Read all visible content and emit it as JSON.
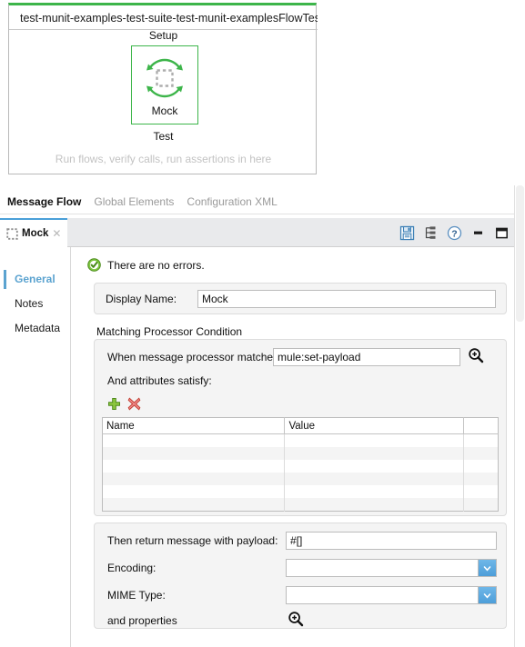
{
  "canvas": {
    "flow_title": "test-munit-examples-test-suite-test-munit-examplesFlowTest",
    "setup_label": "Setup",
    "node_label": "Mock",
    "node_icon": "mock-dashed-square-icon",
    "test_label": "Test",
    "hint_text": "Run flows, verify calls, run assertions in here",
    "accent_color": "#3db54a"
  },
  "view_tabs": [
    {
      "label": "Message Flow",
      "active": true
    },
    {
      "label": "Global Elements",
      "active": false
    },
    {
      "label": "Configuration XML",
      "active": false
    }
  ],
  "editor": {
    "tab_label": "Mock",
    "tab_icon": "mock-dashed-square-icon",
    "tab_close_glyph": "✕",
    "toolbar": [
      {
        "name": "save-icon",
        "title": "Save"
      },
      {
        "name": "outline-tree-icon",
        "title": "Outline"
      },
      {
        "name": "help-icon",
        "title": "Help"
      },
      {
        "name": "minimize-icon",
        "title": "Minimize"
      },
      {
        "name": "maximize-icon",
        "title": "Maximize"
      }
    ],
    "accent_color": "#4a9fd8"
  },
  "side_nav": [
    {
      "label": "General",
      "active": true
    },
    {
      "label": "Notes",
      "active": false
    },
    {
      "label": "Metadata",
      "active": false
    }
  ],
  "form": {
    "status_text": "There are no errors.",
    "status_icon": "green-check-circle-icon",
    "status_color": "#5cb531",
    "display_name_label": "Display Name:",
    "display_name_value": "Mock",
    "display_name_placeholder": "",
    "section_title": "Matching Processor Condition",
    "matcher_label": "When message processor matches:",
    "matcher_value": "mule:set-payload",
    "matcher_placeholder": "",
    "matcher_search_icon": "magnifier-plus-icon",
    "attributes_label": "And attributes satisfy:",
    "add_button_icon": "green-plus-icon",
    "delete_button_icon": "red-x-icon",
    "table": {
      "columns": [
        "Name",
        "Value",
        ""
      ],
      "rows": [
        [
          "",
          "",
          ""
        ],
        [
          "",
          "",
          ""
        ],
        [
          "",
          "",
          ""
        ],
        [
          "",
          "",
          ""
        ],
        [
          "",
          "",
          ""
        ],
        [
          "",
          "",
          ""
        ]
      ]
    },
    "payload_label": "Then return message with payload:",
    "payload_value": "#[]",
    "encoding_label": "Encoding:",
    "encoding_value": "",
    "mime_label": "MIME Type:",
    "mime_value": "",
    "properties_label": "and properties",
    "properties_search_icon": "magnifier-plus-icon",
    "dropdown_arrow_glyph": "˅"
  }
}
